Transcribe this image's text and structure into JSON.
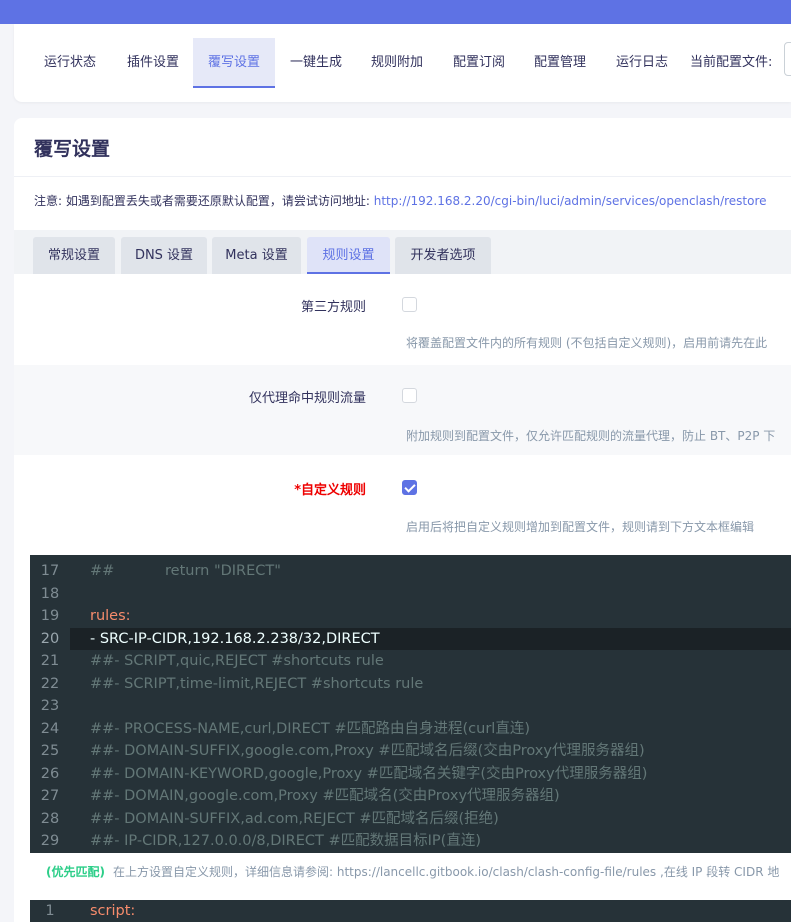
{
  "nav": {
    "items": [
      "运行状态",
      "插件设置",
      "覆写设置",
      "一键生成",
      "规则附加",
      "配置订阅",
      "配置管理",
      "运行日志"
    ],
    "active": "覆写设置",
    "config_label": "当前配置文件:"
  },
  "page": {
    "title": "覆写设置",
    "notice_text": "注意: 如遇到配置丢失或者需要还原默认配置，请尝试访问地址: ",
    "notice_link": "http://192.168.2.20/cgi-bin/luci/admin/services/openclash/restore"
  },
  "tabs": [
    "常规设置",
    "DNS 设置",
    "Meta 设置",
    "规则设置",
    "开发者选项"
  ],
  "settings": [
    {
      "label": "第三方规则",
      "checked": false,
      "desc": "将覆盖配置文件内的所有规则 (不包括自定义规则)，启用前请先在此"
    },
    {
      "label": "仅代理命中规则流量",
      "checked": false,
      "desc": "附加规则到配置文件，仅允许匹配规则的流量代理，防止 BT、P2P 下"
    },
    {
      "label": "*自定义规则",
      "checked": true,
      "desc": "启用后将把自定义规则增加到配置文件，规则请到下方文本框编辑"
    }
  ],
  "editor": {
    "lines": [
      {
        "n": "17",
        "t": "##           return \"DIRECT\""
      },
      {
        "n": "18",
        "t": ""
      },
      {
        "n": "19",
        "t": "rules:"
      },
      {
        "n": "20",
        "t": "- SRC-IP-CIDR,192.168.2.238/32,DIRECT"
      },
      {
        "n": "21",
        "t": "##- SCRIPT,quic,REJECT #shortcuts rule"
      },
      {
        "n": "22",
        "t": "##- SCRIPT,time-limit,REJECT #shortcuts rule"
      },
      {
        "n": "23",
        "t": ""
      },
      {
        "n": "24",
        "t": "##- PROCESS-NAME,curl,DIRECT #匹配路由自身进程(curl直连)"
      },
      {
        "n": "25",
        "t": "##- DOMAIN-SUFFIX,google.com,Proxy #匹配域名后缀(交由Proxy代理服务器组)"
      },
      {
        "n": "26",
        "t": "##- DOMAIN-KEYWORD,google,Proxy #匹配域名关键字(交由Proxy代理服务器组)"
      },
      {
        "n": "27",
        "t": "##- DOMAIN,google.com,Proxy #匹配域名(交由Proxy代理服务器组)"
      },
      {
        "n": "28",
        "t": "##- DOMAIN-SUFFIX,ad.com,REJECT #匹配域名后缀(拒绝)"
      },
      {
        "n": "29",
        "t": "##- IP-CIDR,127.0.0.0/8,DIRECT #匹配数据目标IP(直连)"
      }
    ],
    "highlight_line": "20",
    "key_line": "19"
  },
  "help": {
    "priority": "(优先匹配)",
    "text": "在上方设置自定义规则，详细信息请参阅: ",
    "link": "https://lancellc.gitbook.io/clash/clash-config-file/rules",
    "tail": " ,在线 IP 段转 CIDR 地"
  },
  "editor2": {
    "lines": [
      {
        "n": "1",
        "t": "script:"
      }
    ]
  }
}
